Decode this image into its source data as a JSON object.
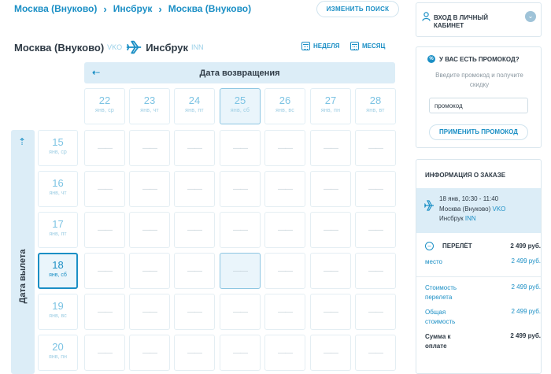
{
  "breadcrumb": [
    "Москва (Внуково)",
    "Инсбрук",
    "Москва (Внуково)"
  ],
  "change_search_label": "ИЗМЕНИТЬ ПОИСК",
  "route": {
    "from_city": "Москва (Внуково)",
    "from_code": "VKO",
    "to_city": "Инсбрук",
    "to_code": "INN"
  },
  "view": {
    "week_label": "НЕДЕЛЯ",
    "month_label": "МЕСЯЦ"
  },
  "return_header": "Дата возвращения",
  "departure_label": "Дата вылета",
  "return_dates": [
    {
      "day": "22",
      "wd": "янв, ср"
    },
    {
      "day": "23",
      "wd": "янв, чт"
    },
    {
      "day": "24",
      "wd": "янв, пт"
    },
    {
      "day": "25",
      "wd": "янв, сб",
      "selected": true
    },
    {
      "day": "26",
      "wd": "янв, вс"
    },
    {
      "day": "27",
      "wd": "янв, пн"
    },
    {
      "day": "28",
      "wd": "янв, вт"
    }
  ],
  "departure_dates": [
    {
      "day": "15",
      "wd": "янв, ср"
    },
    {
      "day": "16",
      "wd": "янв, чт"
    },
    {
      "day": "17",
      "wd": "янв, пт"
    },
    {
      "day": "18",
      "wd": "янв, сб",
      "selected": true
    },
    {
      "day": "19",
      "wd": "янв, вс"
    },
    {
      "day": "20",
      "wd": "янв, пн"
    }
  ],
  "empty_cell_text": "——",
  "login": {
    "line1": "ВХОД В ЛИЧНЫЙ",
    "line2": "КАБИНЕТ"
  },
  "promo": {
    "title": "У ВАС ЕСТЬ ПРОМОКОД?",
    "hint": "Введите промокод и получите скидку",
    "input_value": "промокод",
    "apply_label": "ПРИМЕНИТЬ ПРОМОКОД"
  },
  "order": {
    "title": "ИНФОРМАЦИЯ О ЗАКАЗЕ",
    "flight_time": "18 янв, 10:30 - 11:40",
    "from_city": "Москва (Внуково)",
    "from_code": "VKO",
    "to_city": "Инсбрук",
    "to_code": "INN",
    "segment_label": "ПЕРЕЛЁТ",
    "segment_price": "2 499 руб.",
    "seat_label": "место",
    "seat_price": "2 499 руб.",
    "flight_cost_label": "Стоимость перелета",
    "flight_cost": "2 499 руб.",
    "total_cost_label": "Общая стоимость",
    "total_cost": "2 499 руб.",
    "pay_label": "Сумма к оплате",
    "pay_amount": "2 499 руб."
  },
  "colors": {
    "accent": "#1b8fc5",
    "header_bg": "#dcedf7",
    "text": "#2e3a45"
  }
}
